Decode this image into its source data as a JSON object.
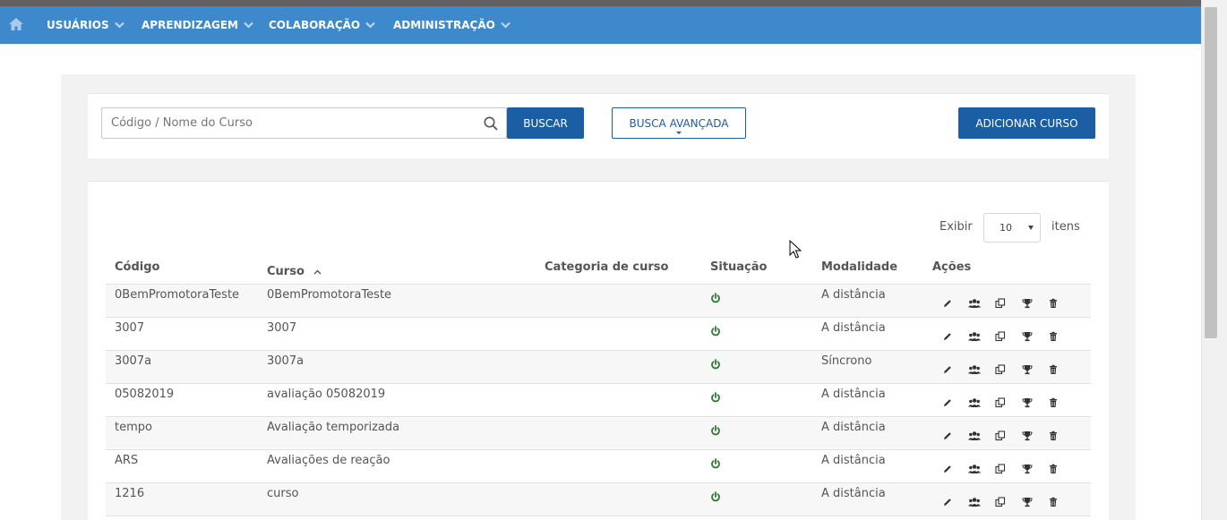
{
  "nav": {
    "items": [
      {
        "label": "USUÁRIOS"
      },
      {
        "label": "APRENDIZAGEM"
      },
      {
        "label": "COLABORAÇÃO"
      },
      {
        "label": "ADMINISTRAÇÃO"
      }
    ]
  },
  "search": {
    "placeholder": "Código / Nome do Curso",
    "search_button": "BUSCAR",
    "advanced_button": "BUSCA AVANÇADA",
    "add_button": "ADICIONAR CURSO"
  },
  "pager": {
    "show_label": "Exibir",
    "page_size": "10",
    "items_label": "itens"
  },
  "table": {
    "headers": {
      "code": "Código",
      "course": "Curso",
      "category": "Categoria de curso",
      "status": "Situação",
      "modality": "Modalidade",
      "actions": "Ações"
    },
    "rows": [
      {
        "code": "0BemPromotoraTeste",
        "course": "0BemPromotoraTeste",
        "category": "",
        "modality": "A distância"
      },
      {
        "code": "3007",
        "course": "3007",
        "category": "",
        "modality": "A distância"
      },
      {
        "code": "3007a",
        "course": "3007a",
        "category": "",
        "modality": "Síncrono"
      },
      {
        "code": "05082019",
        "course": "avaliação 05082019",
        "category": "",
        "modality": "A distância"
      },
      {
        "code": "tempo",
        "course": "Avaliação temporizada",
        "category": "",
        "modality": "A distância"
      },
      {
        "code": "ARS",
        "course": "Avaliações de reação",
        "category": "",
        "modality": "A distância"
      },
      {
        "code": "1216",
        "course": "curso",
        "category": "",
        "modality": "A distância"
      }
    ]
  },
  "icons": {
    "home": "home-icon",
    "search": "search-icon",
    "status": "power-icon",
    "actions": [
      "pencil-icon",
      "users-icon",
      "copy-icon",
      "trophy-icon",
      "trash-icon"
    ]
  },
  "colors": {
    "navbar": "#3e88cc",
    "primary": "#1b5ea3",
    "status_active": "#2e7d32"
  }
}
